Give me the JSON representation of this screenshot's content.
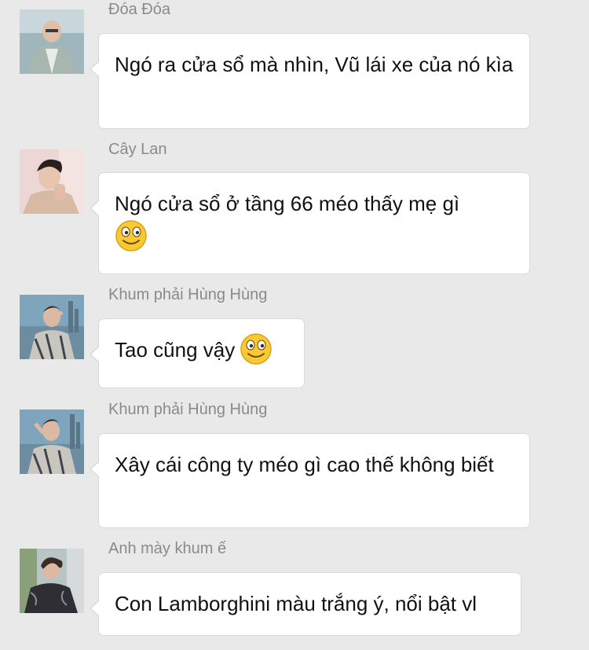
{
  "messages": [
    {
      "sender": "Đóa Đóa",
      "text": "Ngó ra cửa sổ mà nhìn, Vũ lái xe của nó kìa",
      "avatar_icon": "person-photo-avatar",
      "emoji": null
    },
    {
      "sender": "Cây Lan",
      "text": "Ngó cửa sổ ở tầng 66 méo thấy mẹ gì",
      "avatar_icon": "person-photo-avatar",
      "emoji": "smiley-emoji"
    },
    {
      "sender": "Khum phải Hùng Hùng",
      "text": "Tao cũng vậy",
      "avatar_icon": "person-photo-avatar",
      "emoji": "smiley-emoji"
    },
    {
      "sender": "Khum phải Hùng Hùng",
      "text": "Xây cái công ty méo gì cao thế không biết",
      "avatar_icon": "person-photo-avatar",
      "emoji": null
    },
    {
      "sender": "Anh mày khum ế",
      "text": "Con Lamborghini màu trắng ý, nổi bật vl",
      "avatar_icon": "person-photo-avatar",
      "emoji": null
    }
  ],
  "colors": {
    "background": "#e9e9e9",
    "bubble": "#ffffff",
    "bubble_border": "#d9d9d9",
    "sender_name": "#8a8a8a",
    "message_text": "#111111",
    "emoji_face": "#f7c934"
  }
}
